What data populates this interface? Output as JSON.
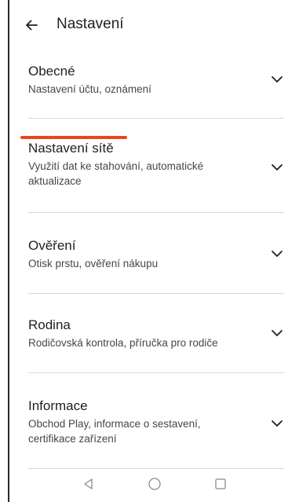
{
  "header": {
    "title": "Nastavení"
  },
  "sections": [
    {
      "title": "Obecné",
      "subtitle": "Nastavení účtu, oznámení"
    },
    {
      "title": "Nastavení sítě",
      "subtitle": "Využití dat ke stahování, automatické aktualizace"
    },
    {
      "title": "Ověření",
      "subtitle": "Otisk prstu, ověření nákupu"
    },
    {
      "title": "Rodina",
      "subtitle": "Rodičovská kontrola, příručka pro rodiče"
    },
    {
      "title": "Informace",
      "subtitle": "Obchod Play, informace o sestavení, certifikace zařízení"
    }
  ],
  "icons": {
    "back": "arrow-left-icon",
    "expand": "chevron-down-icon",
    "nav_back": "triangle-back-icon",
    "nav_home": "circle-home-icon",
    "nav_recents": "square-recents-icon"
  },
  "colors": {
    "annotation_underline": "#e8471b",
    "text_primary": "#1f1f1f",
    "text_secondary": "#444746",
    "divider": "#d9d9d9"
  }
}
